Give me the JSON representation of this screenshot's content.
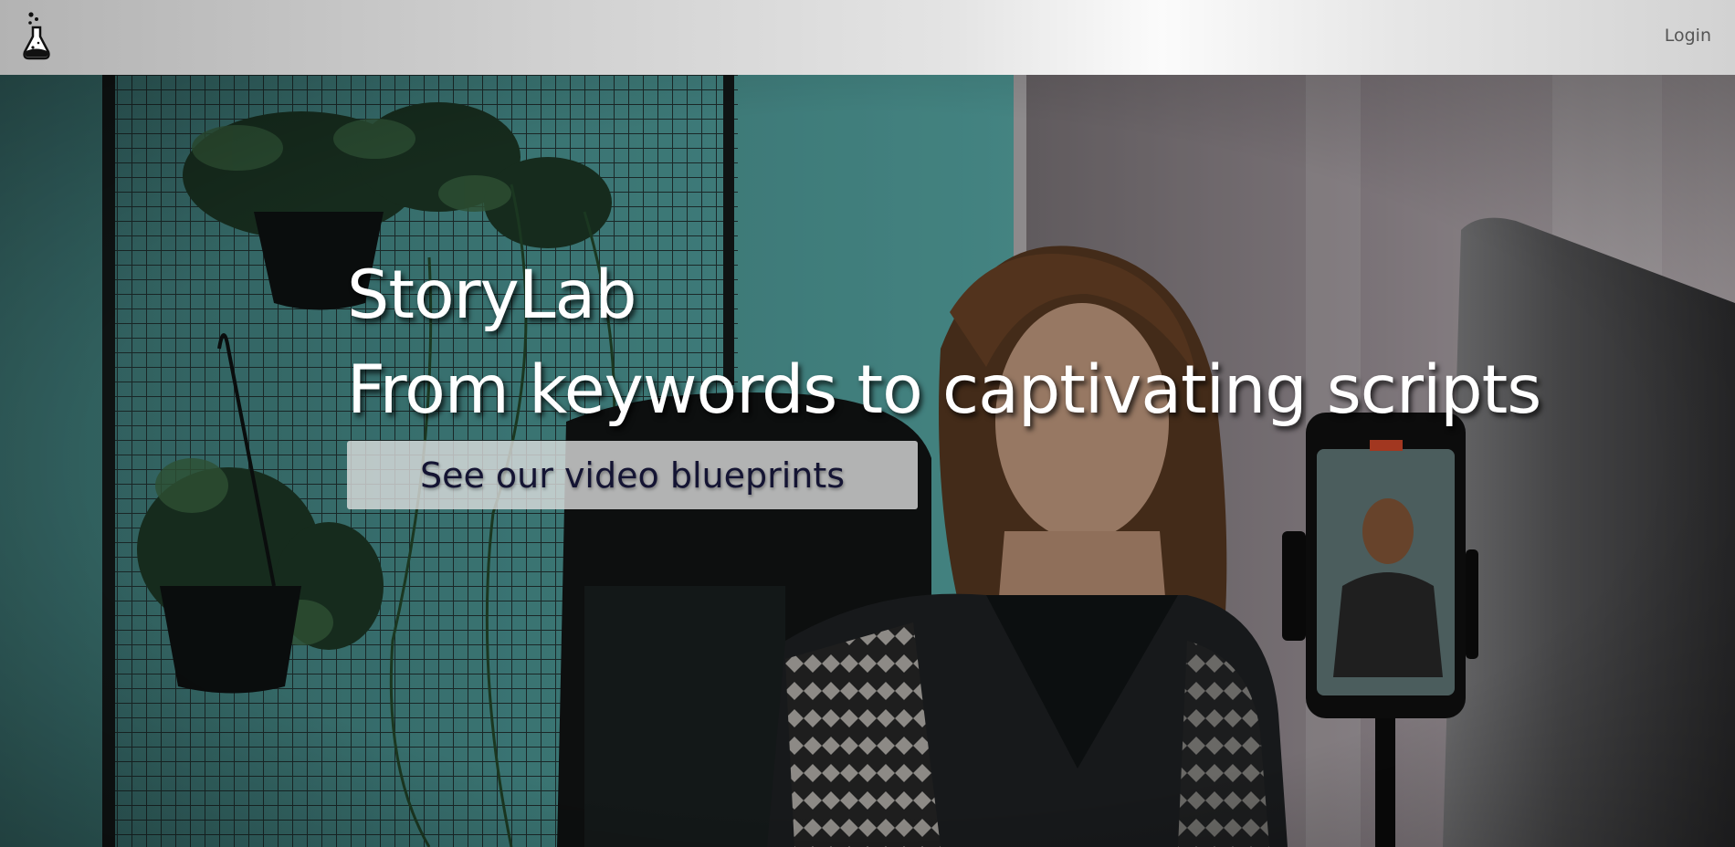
{
  "nav": {
    "logo_icon": "flask-icon",
    "login_label": "Login"
  },
  "hero": {
    "title_line1": "StoryLab",
    "title_line2": "From keywords to captivating scripts",
    "cta_label": "See our video blueprints",
    "background": "photo of a woman seated at a desk filming herself with a phone, plants on a wire grid behind her"
  }
}
